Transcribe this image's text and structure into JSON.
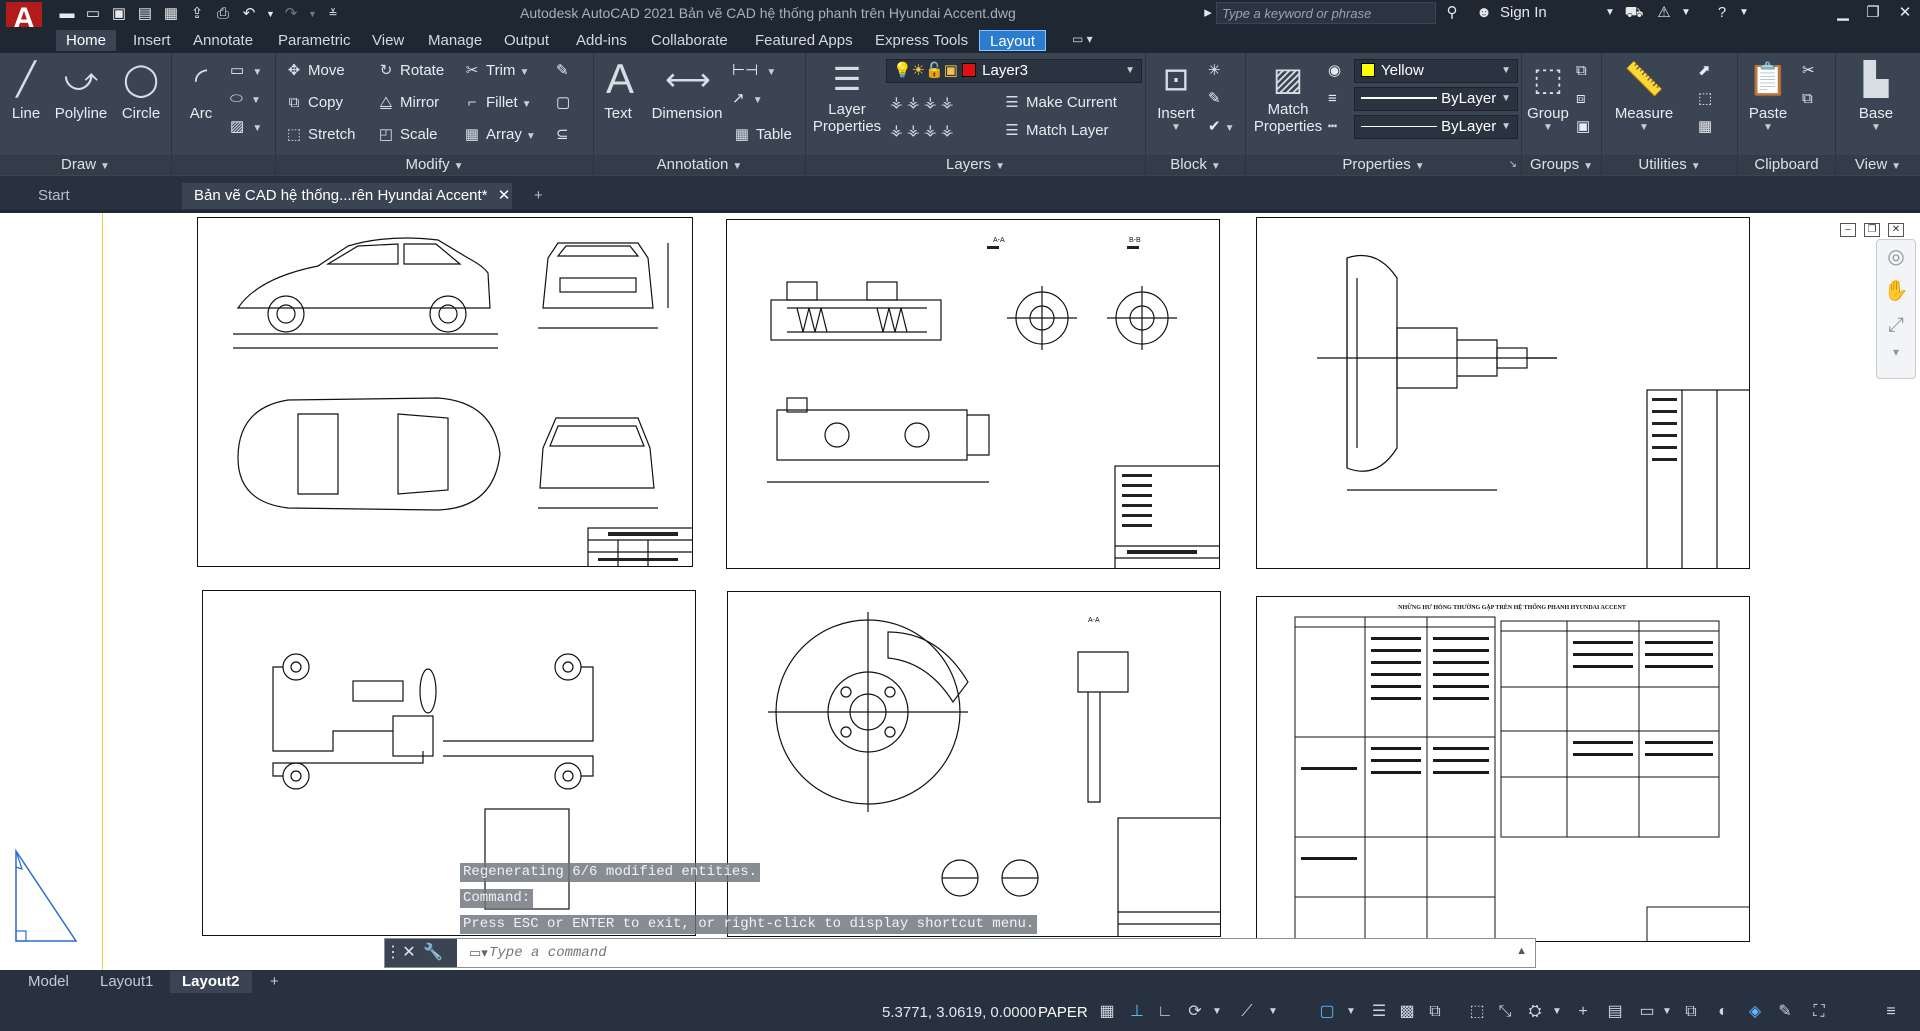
{
  "app": {
    "logo": "A",
    "title": "Autodesk AutoCAD 2021    Bản vẽ CAD hệ thống phanh trên Hyundai Accent.dwg",
    "search_placeholder": "Type a keyword or phrase",
    "sign_in": "Sign In"
  },
  "ribbon_tabs": [
    "Home",
    "Insert",
    "Annotate",
    "Parametric",
    "View",
    "Manage",
    "Output",
    "Add-ins",
    "Collaborate",
    "Featured Apps",
    "Express Tools",
    "Layout"
  ],
  "draw_panel": {
    "title": "Draw",
    "line": "Line",
    "polyline": "Polyline",
    "circle": "Circle",
    "arc": "Arc"
  },
  "modify_panel": {
    "title": "Modify",
    "move": "Move",
    "rotate": "Rotate",
    "trim": "Trim",
    "copy": "Copy",
    "mirror": "Mirror",
    "fillet": "Fillet",
    "stretch": "Stretch",
    "scale": "Scale",
    "array": "Array"
  },
  "annotation_panel": {
    "title": "Annotation",
    "text": "Text",
    "dimension": "Dimension",
    "table": "Table"
  },
  "layers_panel": {
    "title": "Layers",
    "layer_properties_1": "Layer",
    "layer_properties_2": "Properties",
    "current_layer": "Layer3",
    "layer_color": "#e01010",
    "make_current": "Make Current",
    "match_layer": "Match Layer"
  },
  "block_panel": {
    "title": "Block",
    "insert": "Insert"
  },
  "properties_panel": {
    "title": "Properties",
    "match_1": "Match",
    "match_2": "Properties",
    "color": "Yellow",
    "color_hex": "#ffff00",
    "linetype": "ByLayer",
    "lineweight": "ByLayer"
  },
  "groups_panel": {
    "title": "Groups",
    "group": "Group"
  },
  "utilities_panel": {
    "title": "Utilities",
    "measure": "Measure"
  },
  "clipboard_panel": {
    "title": "Clipboard",
    "paste": "Paste"
  },
  "view_panel": {
    "title": "View",
    "base": "Base"
  },
  "doc_tabs": {
    "start": "Start",
    "active": "Bản vẽ CAD hệ thống...rên Hyundai Accent*"
  },
  "sheet6_title": "NHỮNG HƯ HỎNG THƯỜNG GẶP TRÊN HỆ THỐNG PHANH HYUNDAI ACCENT",
  "sheet2_labels": {
    "section_aa": "A-A",
    "section_bb": "B-B"
  },
  "sheet5_labels": {
    "section_aa": "A-A"
  },
  "command_history": [
    "Regenerating 6/6 modified entities.",
    "Command:",
    "Press ESC or ENTER to exit, or right-click to display shortcut menu."
  ],
  "command_placeholder": "Type a command",
  "layout_tabs": {
    "model": "Model",
    "layout1": "Layout1",
    "layout2": "Layout2",
    "add": "+"
  },
  "status": {
    "coords": "5.3771, 3.0619, 0.0000",
    "mode": "PAPER"
  }
}
